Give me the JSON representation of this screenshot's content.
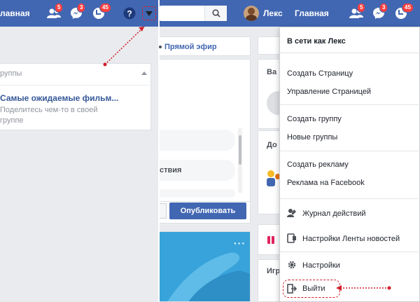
{
  "left_panel": {
    "nav_home": "лавная",
    "friends_count": "5",
    "messages_count": "3",
    "notifications_count": "45",
    "groups_header": "руппы",
    "group_title": "Самые ожидаемые фильм...",
    "group_hint": "Поделитесь чем-то в своей группе"
  },
  "center_panel": {
    "live_label": "Прямой эфир",
    "item_partial": "ствия",
    "publish_label": "Опубликовать"
  },
  "right_panel": {
    "user_name": "Лекс",
    "nav_home": "Главная",
    "friends_count": "5",
    "messages_count": "3",
    "notifications_count": "45",
    "side_va": "Ва",
    "side_do": "До",
    "side_igr": "Игр"
  },
  "menu": {
    "online": "В сети как Лекс",
    "create_page": "Создать Страницу",
    "manage_pages": "Управление Страницей",
    "create_group": "Создать группу",
    "new_groups": "Новые группы",
    "create_ad": "Создать рекламу",
    "ads_on_fb": "Реклама на Facebook",
    "activity_log": "Журнал действий",
    "news_feed_prefs": "Настройки Ленты новостей",
    "settings": "Настройки",
    "logout": "Выйти"
  },
  "colors": {
    "brand_blue": "#4267b2",
    "badge_red": "#fa3e3e",
    "annotation_red": "#d11f2a"
  }
}
